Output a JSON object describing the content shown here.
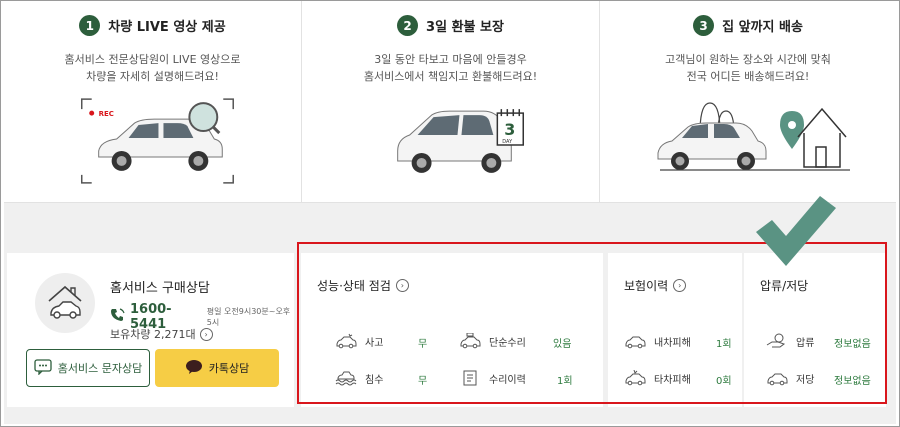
{
  "features": [
    {
      "num": "1",
      "title": "차량 LIVE 영상 제공",
      "desc1": "홈서비스 전문상담원이 LIVE 영상으로",
      "desc2": "차량을 자세히 설명해드려요!",
      "rec": "REC"
    },
    {
      "num": "2",
      "title": "3일 환불 보장",
      "desc1": "3일 동안 타보고 마음에 안들경우",
      "desc2": "홈서비스에서 책임지고 환불해드려요!",
      "cal_num": "3",
      "cal_day": "DAY"
    },
    {
      "num": "3",
      "title": "집 앞까지 배송",
      "desc1": "고객님이 원하는 장소와 시간에 맞춰",
      "desc2": "전국 어디든 배송해드려요!"
    }
  ],
  "consult": {
    "title": "홈서비스 구매상담",
    "phone": "1600-5441",
    "hours": "평일 오전9시30분~오후5시",
    "stock": "보유차량 2,271대",
    "sms_label": "홈서비스 문자상담",
    "kakao_label": "카톡상담"
  },
  "inspection": {
    "title": "성능·상태 점검",
    "items": [
      {
        "label": "사고",
        "value": "무"
      },
      {
        "label": "단순수리",
        "value": "있음"
      },
      {
        "label": "침수",
        "value": "무"
      },
      {
        "label": "수리이력",
        "value": "1회"
      }
    ]
  },
  "insurance": {
    "title": "보험이력",
    "items": [
      {
        "label": "내차피해",
        "value": "1회"
      },
      {
        "label": "타차피해",
        "value": "0회"
      }
    ]
  },
  "lien": {
    "title": "압류/저당",
    "items": [
      {
        "label": "압류",
        "value": "정보없음"
      },
      {
        "label": "저당",
        "value": "정보없음"
      }
    ]
  },
  "colors": {
    "brand_green": "#2d5e3c",
    "value_green": "#2d7a3e",
    "kakao_yellow": "#f6cd45",
    "highlight_red": "#d9161c",
    "check_green": "#5a9383"
  }
}
